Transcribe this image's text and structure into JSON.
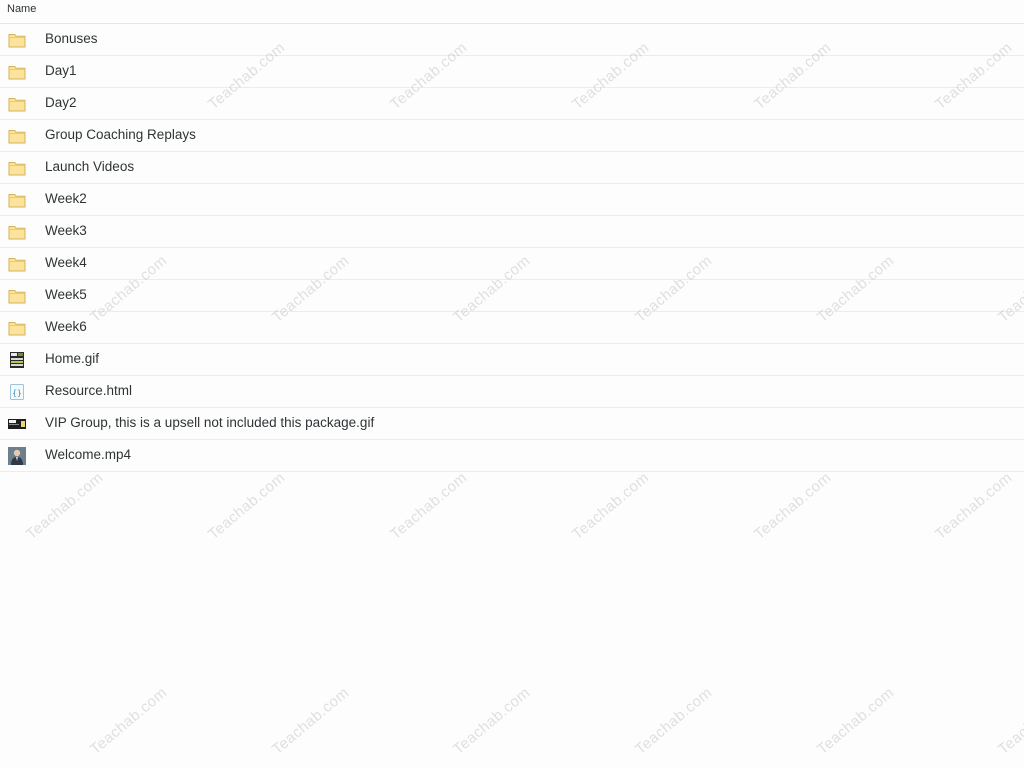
{
  "header": {
    "name_column": "Name"
  },
  "files": [
    {
      "label": "Bonuses",
      "icon": "folder-icon"
    },
    {
      "label": "Day1",
      "icon": "folder-icon"
    },
    {
      "label": "Day2",
      "icon": "folder-icon"
    },
    {
      "label": "Group Coaching Replays",
      "icon": "folder-icon"
    },
    {
      "label": "Launch Videos",
      "icon": "folder-icon"
    },
    {
      "label": "Week2",
      "icon": "folder-icon"
    },
    {
      "label": "Week3",
      "icon": "folder-icon"
    },
    {
      "label": "Week4",
      "icon": "folder-icon"
    },
    {
      "label": "Week5",
      "icon": "folder-icon"
    },
    {
      "label": "Week6",
      "icon": "folder-icon"
    },
    {
      "label": "Home.gif",
      "icon": "gif-thumbnail-icon"
    },
    {
      "label": "Resource.html",
      "icon": "html-file-icon"
    },
    {
      "label": "VIP Group, this is a upsell not included this package.gif",
      "icon": "gif-thumbnail-icon"
    },
    {
      "label": "Welcome.mp4",
      "icon": "video-thumbnail-icon"
    }
  ],
  "watermark": {
    "text": "Teachab.com"
  },
  "colors": {
    "folder_fill": "#fbe39a",
    "folder_stroke": "#d4b25a",
    "row_divider": "#ececec",
    "text": "#2e3436"
  }
}
